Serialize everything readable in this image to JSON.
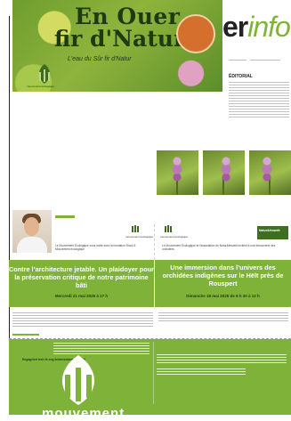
{
  "banner": {
    "title_line1": "En Ouer",
    "title_line2": "fir d'Natur",
    "subtitle": "L'eau du Sûr fir d'Natur",
    "logo_label": "mouvement écologique"
  },
  "masthead": {
    "brand_part1": "er",
    "brand_part2": "info"
  },
  "editorial": {
    "title": "ÉDITORIAL"
  },
  "events": [
    {
      "title": "Contre l’architecture jetable. Un plaidoyer pour la préservation critique de notre patrimoine bâti",
      "date": "Mercredi 21 mai 2025 à 17 h",
      "logo_label": "mouvement écologique",
      "caption": "Le Mouvement Écologique vous invite avec la fondation Stock & Mouvement écologique"
    },
    {
      "title": "Une immersion dans l’univers des orchidées indigènes sur le Hëlt près de Rouspert",
      "date": "Dimanche 18 mai 2025 de 9 h 30 à 12 h",
      "logo_label": "mouvement écologique",
      "caption": "Le Mouvement Écologique et l'association de Natur&ëmwelt invitent à une découverte des orchidées",
      "partner_badge": "Natur&ëmwelt"
    }
  ],
  "footer": {
    "heading": "Engagéiert Iech fir eng liewenswäert Zukunft!",
    "wordmark": "mouvement"
  },
  "colors": {
    "accent_green": "#7fb239",
    "dark_green": "#1d3a12"
  }
}
